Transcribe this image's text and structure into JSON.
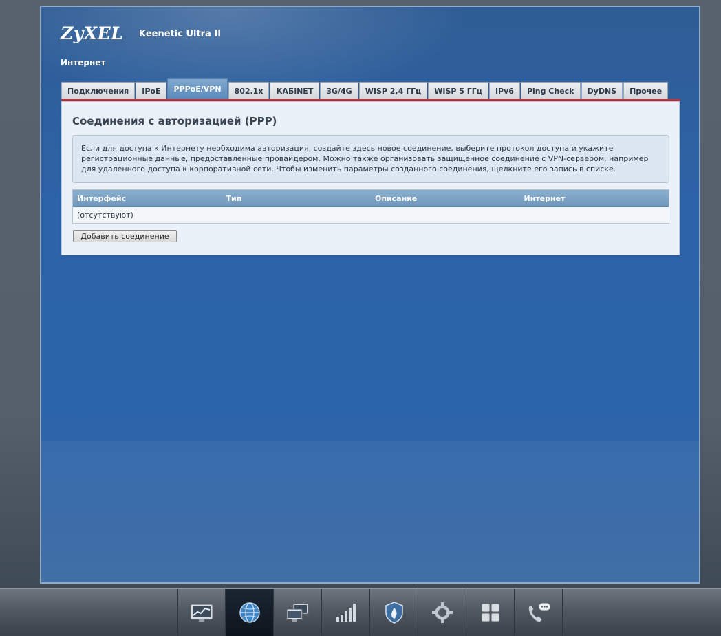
{
  "header": {
    "logo": "ZyXEL",
    "model": "Keenetic Ultra II",
    "section_title": "Интернет"
  },
  "tabs": [
    {
      "label": "Подключения"
    },
    {
      "label": "IPoE"
    },
    {
      "label": "PPPoE/VPN",
      "active": true
    },
    {
      "label": "802.1x"
    },
    {
      "label": "КАБiNET"
    },
    {
      "label": "3G/4G"
    },
    {
      "label": "WISP 2,4 ГГц"
    },
    {
      "label": "WISP 5 ГГц"
    },
    {
      "label": "IPv6"
    },
    {
      "label": "Ping Check"
    },
    {
      "label": "DyDNS"
    },
    {
      "label": "Прочее"
    }
  ],
  "panel": {
    "title": "Соединения с авторизацией (PPP)",
    "info": "Если для доступа к Интернету необходима авторизация, создайте здесь новое соединение, выберите протокол доступа и укажите регистрационные данные, предоставленные провайдером. Можно также организовать защищенное соединение с VPN-сервером, например для удаленного доступа к корпоративной сети. Чтобы изменить параметры созданного соединения, щелкните его запись в списке.",
    "table": {
      "columns": [
        "Интерфейс",
        "Тип",
        "Описание",
        "Интернет"
      ],
      "empty_row": "(отсутствуют)"
    },
    "add_button": "Добавить соединение"
  },
  "dock": {
    "items": [
      {
        "icon": "monitor-chart-icon"
      },
      {
        "icon": "globe-icon",
        "active": true
      },
      {
        "icon": "computers-icon"
      },
      {
        "icon": "signal-bars-icon"
      },
      {
        "icon": "shield-flame-icon"
      },
      {
        "icon": "gear-icon"
      },
      {
        "icon": "apps-grid-icon"
      },
      {
        "icon": "phone-chat-icon"
      }
    ]
  },
  "colors": {
    "accent_red": "#c0343c",
    "tab_active": "#6b96c2",
    "frame_blue": "#2c64ab"
  }
}
